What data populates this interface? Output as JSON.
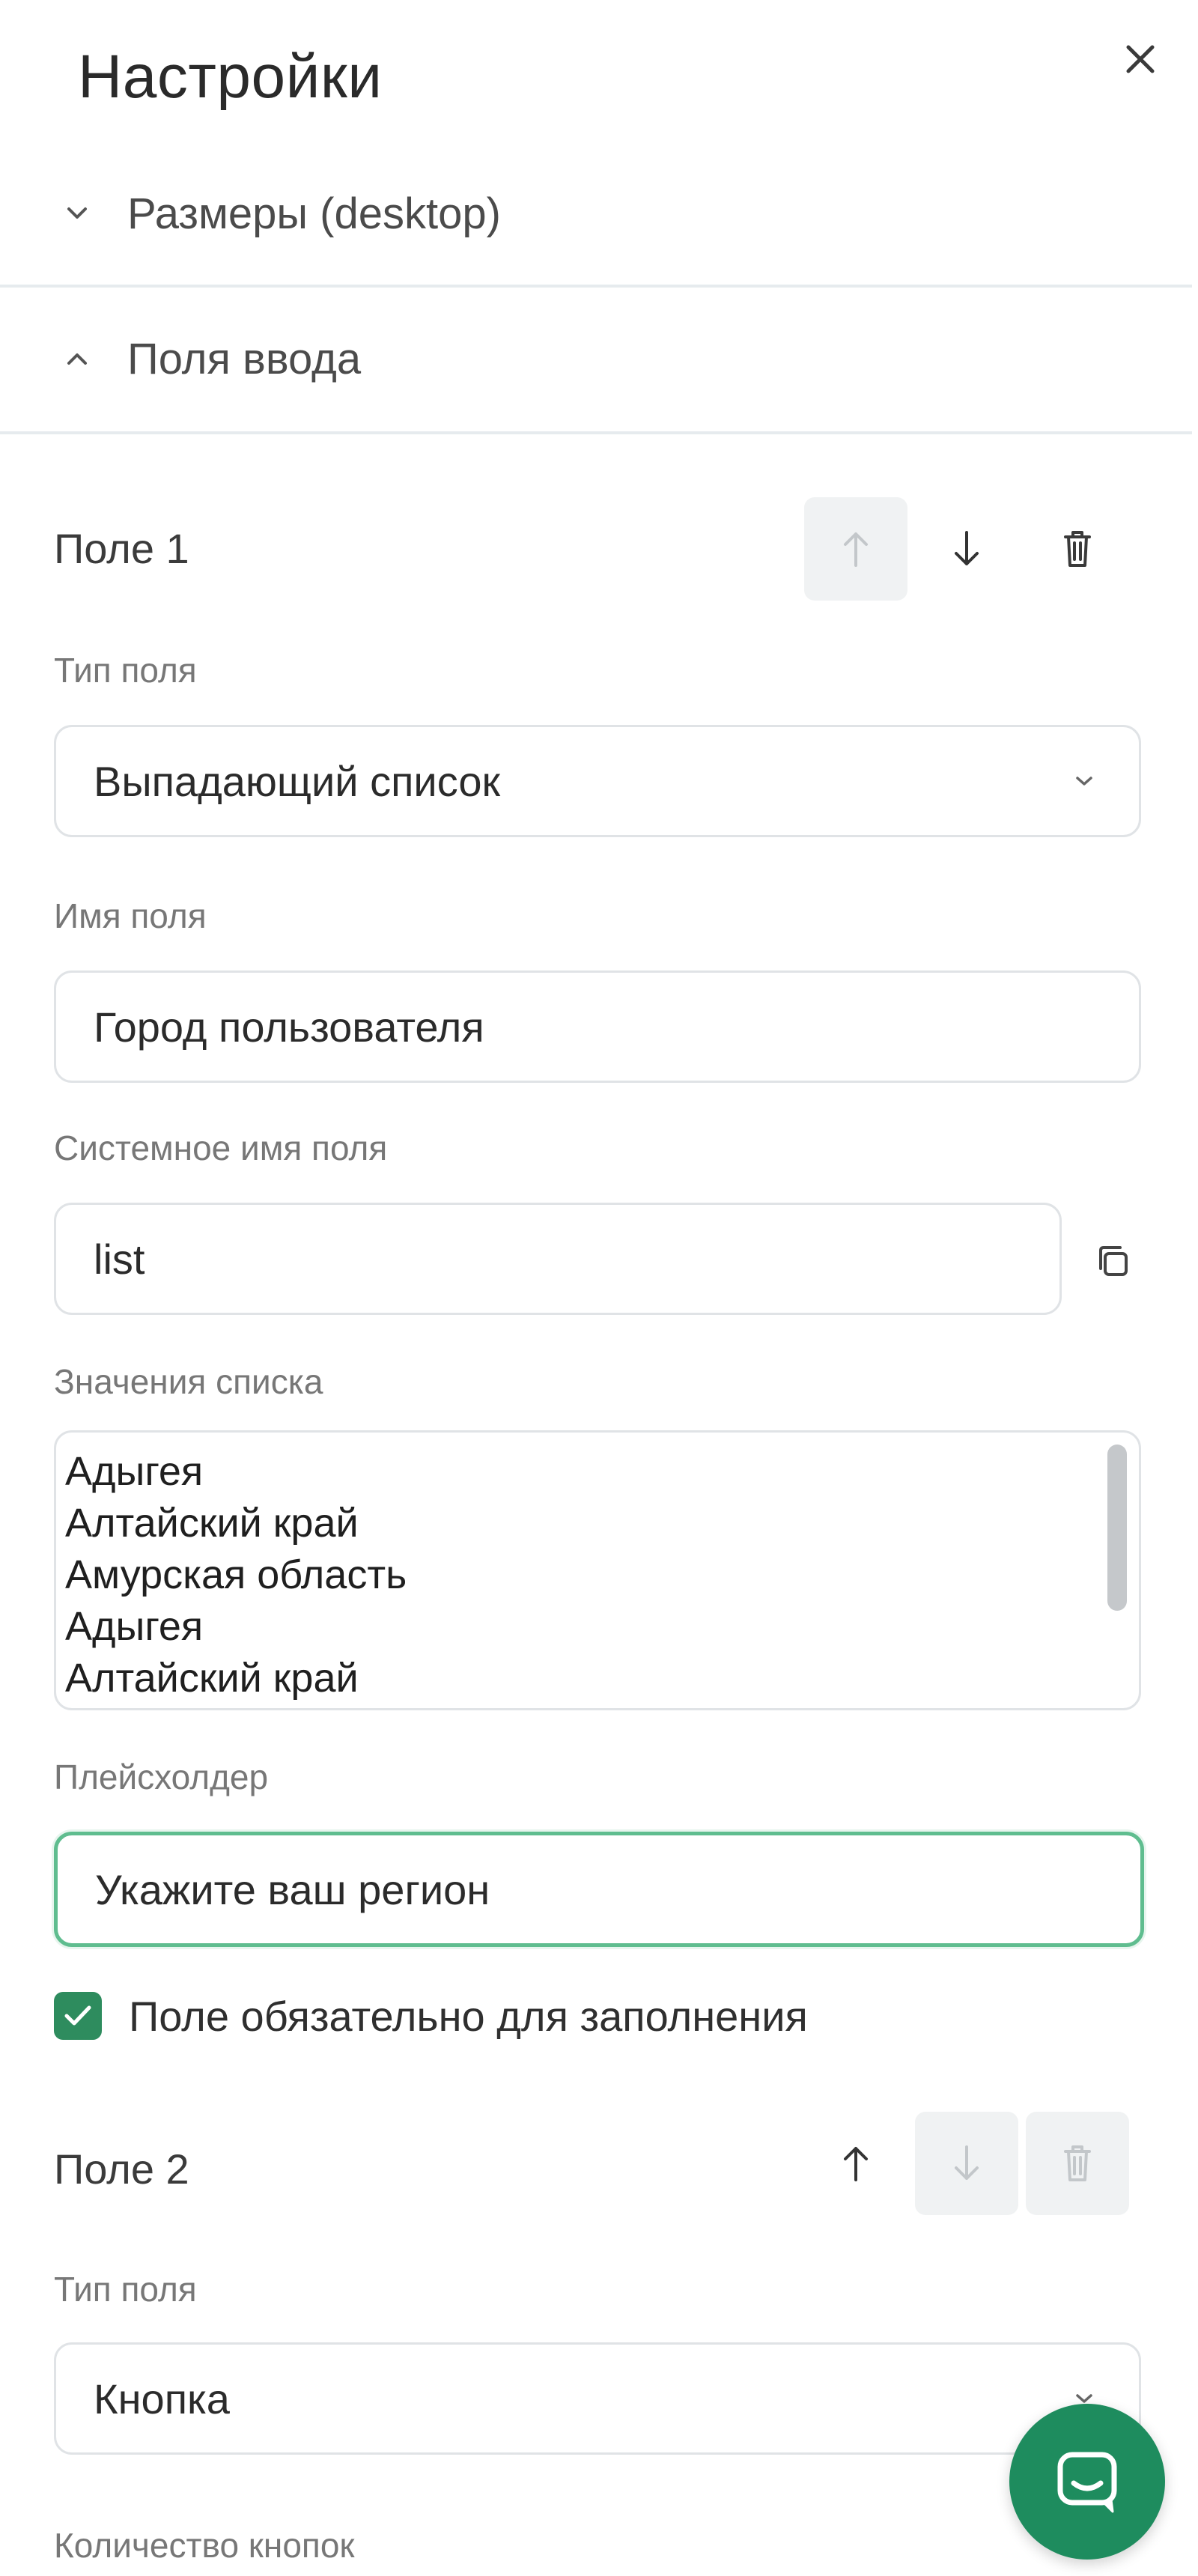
{
  "header": {
    "title": "Настройки",
    "close_icon": "close-icon"
  },
  "sections": {
    "sizes": {
      "label": "Размеры (desktop)",
      "icon": "chevron-down-icon",
      "expanded": false
    },
    "inputs": {
      "label": "Поля ввода",
      "icon": "chevron-up-icon",
      "expanded": true
    }
  },
  "field1": {
    "title": "Поле 1",
    "actions": {
      "move_up": {
        "icon": "arrow-up-icon",
        "disabled": true
      },
      "move_down": {
        "icon": "arrow-down-icon",
        "disabled": false
      },
      "delete": {
        "icon": "trash-icon",
        "disabled": false
      }
    },
    "type_label": "Тип поля",
    "type_value": "Выпадающий список",
    "name_label": "Имя поля",
    "name_value": "Город пользователя",
    "system_name_label": "Системное имя поля",
    "system_name_value": "list",
    "copy_icon": "copy-icon",
    "list_values_label": "Значения списка",
    "list_values": [
      "Адыгея",
      "Алтайский край",
      "Амурская область",
      "Адыгея",
      "Алтайский край"
    ],
    "placeholder_label": "Плейсхолдер",
    "placeholder_value": "Укажите ваш регион",
    "required_checked": true,
    "required_label": "Поле обязательно для заполнения"
  },
  "field2": {
    "title": "Поле 2",
    "actions": {
      "move_up": {
        "icon": "arrow-up-icon",
        "disabled": false
      },
      "move_down": {
        "icon": "arrow-down-icon",
        "disabled": true
      },
      "delete": {
        "icon": "trash-icon",
        "disabled": true
      }
    },
    "type_label": "Тип поля",
    "type_value": "Кнопка",
    "buttons_count_label": "Количество кнопок"
  },
  "chat_widget": {
    "icon": "chat-icon"
  },
  "colors": {
    "accent": "#2e8c5e",
    "focus_border": "#5fbd8f",
    "border": "#e0e3e6",
    "disabled_bg": "#f0f2f3"
  }
}
